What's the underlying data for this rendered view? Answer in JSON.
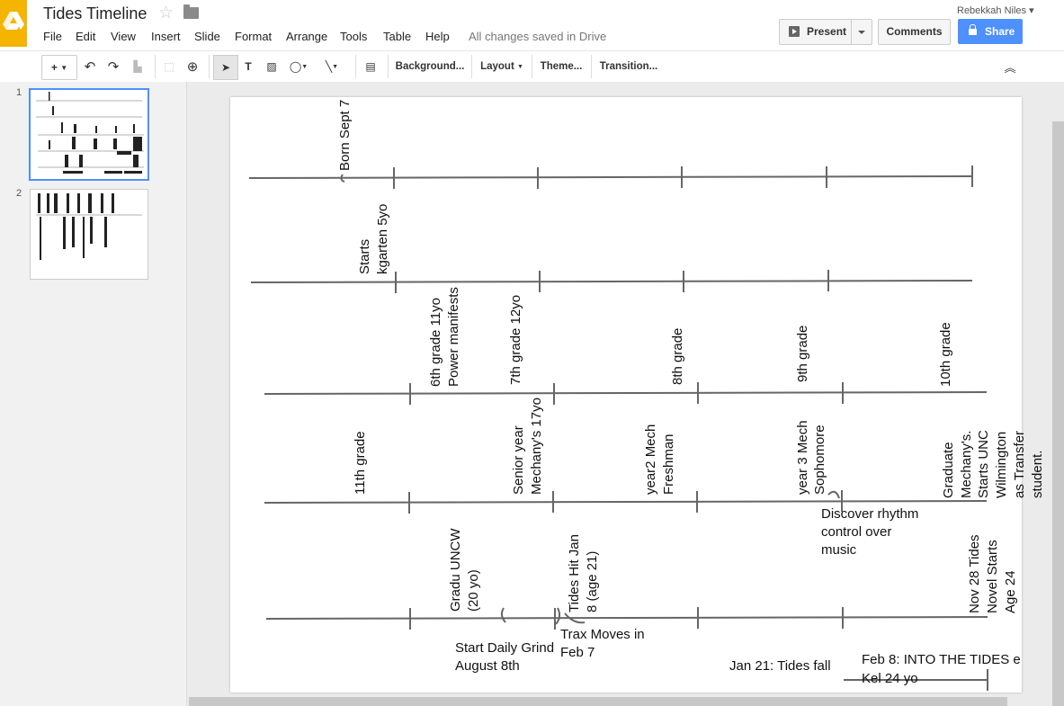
{
  "app": {
    "doc_title": "Tides Timeline",
    "user": "Rebekkah Niles",
    "save_status": "All changes saved in Drive",
    "accent_color": "#4d90fe",
    "logo_color": "#f4b400"
  },
  "menu": [
    "File",
    "Edit",
    "View",
    "Insert",
    "Slide",
    "Format",
    "Arrange",
    "Tools",
    "Table",
    "Help"
  ],
  "buttons": {
    "present": "Present",
    "comments": "Comments",
    "share": "Share"
  },
  "toolbar": {
    "background": "Background...",
    "layout": "Layout",
    "theme": "Theme...",
    "transition": "Transition..."
  },
  "slides": {
    "numbers": [
      "1",
      "2"
    ],
    "selected": "1"
  },
  "timeline": {
    "born": "Born Sept 7",
    "kindergarten_1": "Starts",
    "kindergarten_2": "kgarten 5yo",
    "grade6_1": "6th grade 11yo",
    "grade6_2": "Power manifests",
    "grade7": "7th grade 12yo",
    "grade8": "8th grade",
    "grade9": "9th grade",
    "grade10": "10th grade",
    "grade11": "11th grade",
    "senior_1": "Senior year",
    "senior_2": "Mechany's 17yo",
    "year2_1": "year2 Mech",
    "year2_2": "Freshman",
    "year3_1": "year 3 Mech",
    "year3_2": "Sophomore",
    "grad_1": "Graduate",
    "grad_2": "Mechany's.",
    "grad_3": "Starts UNC",
    "grad_4": "Wilmington",
    "grad_5": "as Transfer",
    "grad_6": "student.",
    "rhythm_1": "Discover rhythm",
    "rhythm_2": "control over",
    "rhythm_3": "music",
    "gradu_1": "Gradu UNCW",
    "gradu_2": "(20 yo)",
    "tides_hit_1": "Tides Hit Jan",
    "tides_hit_2": "8 (age 21)",
    "nov28_1": "Nov 28 Tides",
    "nov28_2": "Novel Starts",
    "nov28_3": "Age 24",
    "daily_1": "Start Daily Grind",
    "daily_2": "August 8th",
    "trax_1": "Trax Moves in",
    "trax_2": "Feb 7",
    "tides_fall": "Jan 21: Tides fall",
    "into_1": "Feb 8: INTO THE TIDES e",
    "into_2": "Kel 24 yo"
  }
}
